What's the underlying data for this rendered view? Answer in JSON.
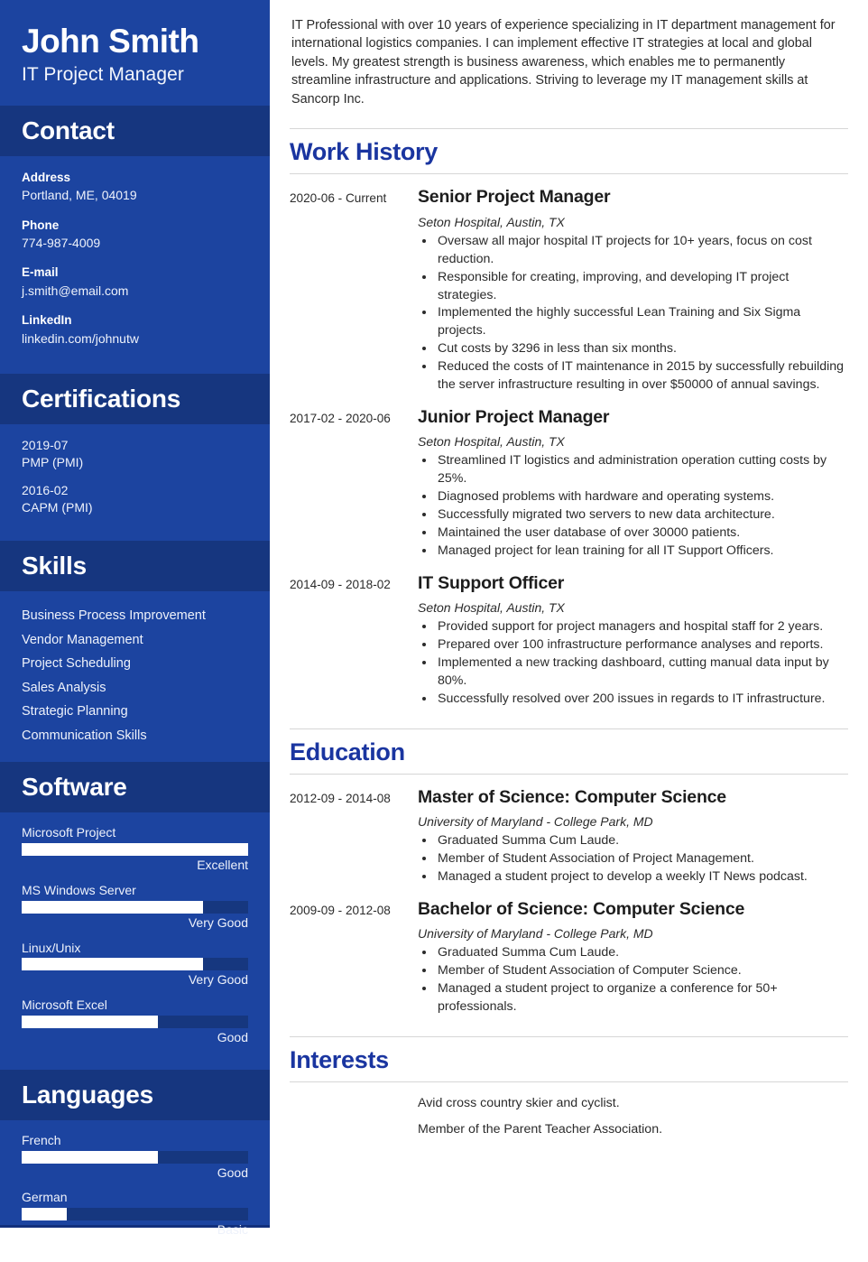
{
  "colors": {
    "sidebar_bg": "#1c44a0",
    "sidebar_head_bg": "#16367f",
    "meter_track": "#16377f",
    "meter_fill": "#ffffff",
    "heading_blue": "#1a35a0",
    "body_text": "#2b2b2b",
    "rule": "#d6d6d6"
  },
  "sidebar": {
    "name": "John Smith",
    "title": "IT Project Manager",
    "contact": {
      "heading": "Contact",
      "fields": [
        {
          "label": "Address",
          "value": "Portland, ME, 04019"
        },
        {
          "label": "Phone",
          "value": "774-987-4009"
        },
        {
          "label": "E-mail",
          "value": "j.smith@email.com"
        },
        {
          "label": "LinkedIn",
          "value": "linkedin.com/johnutw"
        }
      ]
    },
    "certifications": {
      "heading": "Certifications",
      "items": [
        {
          "date": "2019-07",
          "name": "PMP (PMI)"
        },
        {
          "date": "2016-02",
          "name": "CAPM (PMI)"
        }
      ]
    },
    "skills": {
      "heading": "Skills",
      "items": [
        "Business Process Improvement",
        "Vendor Management",
        "Project Scheduling",
        "Sales Analysis",
        "Strategic Planning",
        "Communication Skills"
      ]
    },
    "software": {
      "heading": "Software",
      "items": [
        {
          "label": "Microsoft Project",
          "level": "Excellent",
          "percent": 100
        },
        {
          "label": "MS Windows Server",
          "level": "Very Good",
          "percent": 80
        },
        {
          "label": "Linux/Unix",
          "level": "Very Good",
          "percent": 80
        },
        {
          "label": "Microsoft Excel",
          "level": "Good",
          "percent": 60
        }
      ]
    },
    "languages": {
      "heading": "Languages",
      "items": [
        {
          "label": "French",
          "level": "Good",
          "percent": 60
        },
        {
          "label": "German",
          "level": "Basic",
          "percent": 20
        }
      ]
    }
  },
  "main": {
    "summary": "IT Professional with over 10 years of experience specializing in IT department management for international logistics companies. I can implement effective IT strategies at local and global levels. My greatest strength is business awareness, which enables me to permanently streamline infrastructure and applications. Striving to leverage my IT management skills at Sancorp Inc.",
    "work_history": {
      "heading": "Work History",
      "entries": [
        {
          "dates": "2020-06 - Current",
          "title": "Senior Project Manager",
          "org": "Seton Hospital, Austin, TX",
          "points": [
            "Oversaw all major hospital IT projects for 10+ years, focus on cost reduction.",
            "Responsible for creating, improving, and developing IT project strategies.",
            "Implemented the highly successful Lean Training and Six Sigma projects.",
            "Cut costs by 3296 in less than six months.",
            "Reduced the costs of IT maintenance in 2015 by successfully rebuilding the server infrastructure resulting in over $50000 of annual savings."
          ]
        },
        {
          "dates": "2017-02 - 2020-06",
          "title": "Junior Project Manager",
          "org": "Seton Hospital, Austin, TX",
          "points": [
            "Streamlined IT logistics and administration operation cutting costs by 25%.",
            "Diagnosed problems with hardware and operating systems.",
            "Successfully migrated two servers to new data architecture.",
            "Maintained the user database of over 30000 patients.",
            "Managed project for lean training for all IT Support Officers."
          ]
        },
        {
          "dates": "2014-09 - 2018-02",
          "title": "IT Support Officer",
          "org": "Seton Hospital, Austin, TX",
          "points": [
            "Provided support for project managers and hospital staff for 2 years.",
            "Prepared over 100 infrastructure performance analyses and reports.",
            "Implemented a new tracking dashboard, cutting manual data input by 80%.",
            "Successfully resolved over 200 issues in regards to IT infrastructure."
          ]
        }
      ]
    },
    "education": {
      "heading": "Education",
      "entries": [
        {
          "dates": "2012-09 - 2014-08",
          "title": "Master of Science: Computer Science",
          "org": "University of Maryland - College Park, MD",
          "points": [
            "Graduated Summa Cum Laude.",
            "Member of Student Association of Project Management.",
            "Managed a student project to develop a weekly IT News podcast."
          ]
        },
        {
          "dates": "2009-09 - 2012-08",
          "title": "Bachelor of Science: Computer Science",
          "org": "University of Maryland - College Park, MD",
          "points": [
            "Graduated Summa Cum Laude.",
            "Member of Student Association of Computer Science.",
            "Managed a student project to organize a conference for 50+ professionals."
          ]
        }
      ]
    },
    "interests": {
      "heading": "Interests",
      "items": [
        "Avid cross country skier and cyclist.",
        "Member of the Parent Teacher Association."
      ]
    }
  }
}
